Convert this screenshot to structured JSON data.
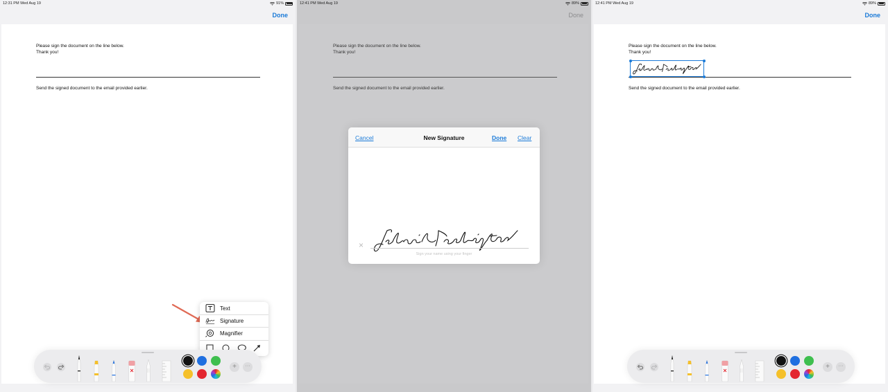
{
  "panels": [
    {
      "status": {
        "time": "12:31 PM  Wed Aug 19",
        "battery": "91%"
      },
      "done_label": "Done"
    },
    {
      "status": {
        "time": "12:41 PM  Wed Aug 19",
        "battery": "89%"
      },
      "done_label": "Done"
    },
    {
      "status": {
        "time": "12:41 PM  Wed Aug 19",
        "battery": "89%"
      },
      "done_label": "Done"
    }
  ],
  "document": {
    "line1": "Please sign the document on the line below.",
    "line2": "Thank you!",
    "line3": "Send the signed document to the email provided earlier."
  },
  "popup_menu": {
    "items": [
      {
        "label": "Text",
        "icon": "text-box-icon"
      },
      {
        "label": "Signature",
        "icon": "signature-icon"
      },
      {
        "label": "Magnifier",
        "icon": "magnifier-icon"
      }
    ],
    "shapes": [
      "square-icon",
      "circle-icon",
      "speech-bubble-icon",
      "arrow-icon"
    ]
  },
  "signature_modal": {
    "cancel_label": "Cancel",
    "title": "New Signature",
    "done_label": "Done",
    "clear_label": "Clear",
    "hint": "Sign your name using your finger",
    "clear_x": "×"
  },
  "toolbar": {
    "tools": [
      "pen-icon",
      "highlighter-icon",
      "pencil-icon",
      "eraser-icon",
      "lasso-icon",
      "ruler-icon"
    ],
    "colors": [
      "#111111",
      "#1f6fe0",
      "#3fbf4f",
      "#f5c02a",
      "#e3262f"
    ],
    "selected_color": "#111111",
    "plus": "+",
    "more": "···"
  },
  "colors": {
    "accent": "#1a7ad8"
  }
}
